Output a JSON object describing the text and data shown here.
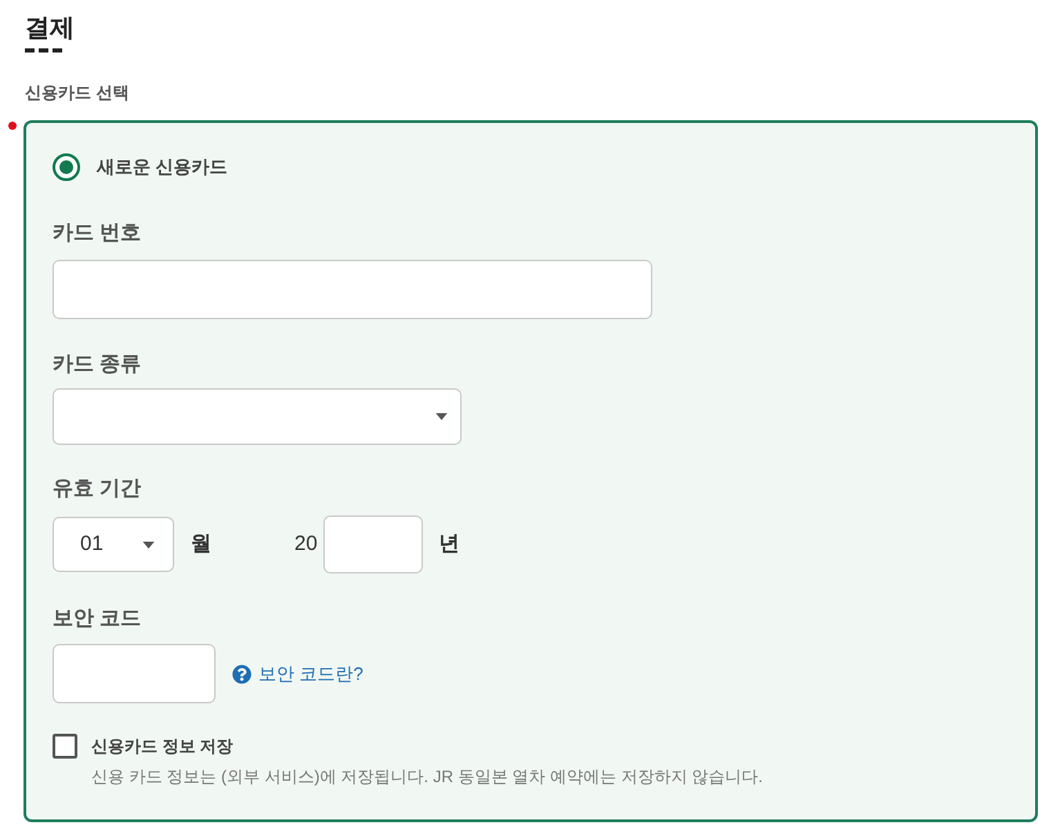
{
  "section": {
    "title": "결제",
    "subtitle": "신용카드 선택",
    "required": true
  },
  "card_options": [
    {
      "label": "새로운 신용카드",
      "selected": true
    }
  ],
  "fields": [
    {
      "kind": "text",
      "label": "카드 번호"
    },
    {
      "kind": "select",
      "label": "카드 종류"
    },
    {
      "kind": "expiry",
      "label": "유효 기간",
      "month": "01",
      "month_unit": "월",
      "year_prefix": "20",
      "year_unit": "년"
    },
    {
      "kind": "cvc",
      "label": "보안 코드",
      "help_link": "보안 코드란?"
    }
  ],
  "save_option": {
    "label": "신용카드 정보 저장",
    "checked": false,
    "description": "신용 카드 정보는 (외부 서비스)에 저장됩니다. JR 동일본 열차 예약에는 저장하지 않습니다."
  }
}
